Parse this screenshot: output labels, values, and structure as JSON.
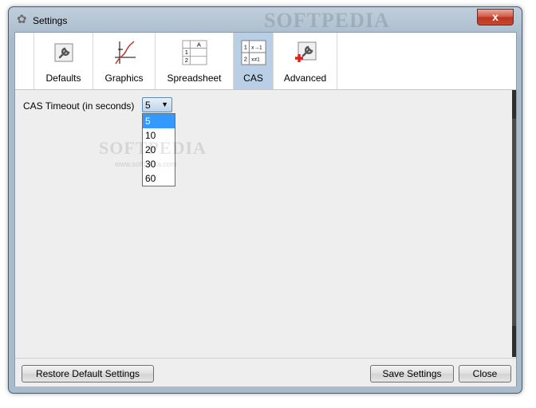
{
  "window": {
    "title": "Settings",
    "watermark": "SOFTPEDIA",
    "close_glyph": "x"
  },
  "tabs": [
    {
      "label": "Defaults",
      "icon": "wrench-icon",
      "active": false
    },
    {
      "label": "Graphics",
      "icon": "graph-icon",
      "active": false
    },
    {
      "label": "Spreadsheet",
      "icon": "spreadsheet-icon",
      "active": false
    },
    {
      "label": "CAS",
      "icon": "cas-table-icon",
      "active": true
    },
    {
      "label": "Advanced",
      "icon": "wrench-plus-icon",
      "active": false
    }
  ],
  "cas": {
    "timeout_label": "CAS Timeout (in seconds)",
    "timeout_value": "5",
    "options": [
      "5",
      "10",
      "20",
      "30",
      "60"
    ],
    "selected_index": 0
  },
  "icons": {
    "spreadsheet_header": "A",
    "spreadsheet_rows": [
      "1",
      "2"
    ],
    "cas_rows": [
      "1",
      "2"
    ],
    "cas_exprs": [
      "x→1",
      "x≠1"
    ]
  },
  "watermark_mid": "SOFTPEDIA",
  "watermark_sub": "www.softpedia.com",
  "footer": {
    "restore_label": "Restore Default Settings",
    "save_label": "Save Settings",
    "close_label": "Close"
  },
  "colors": {
    "active_tab": "#b8cfe6",
    "selected_option": "#3399ff",
    "close_button": "#c9472f"
  }
}
